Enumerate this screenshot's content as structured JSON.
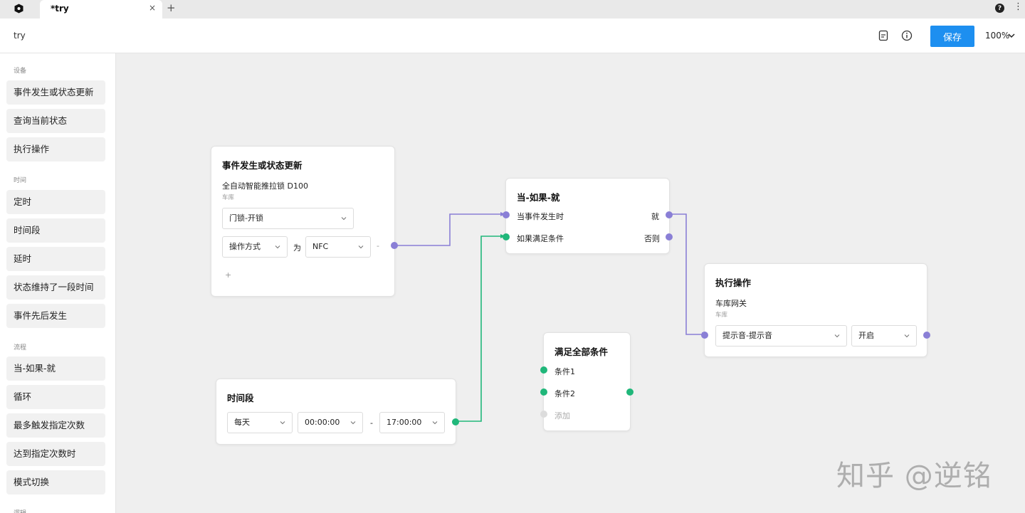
{
  "tabbar": {
    "tab_title": "*try",
    "tab_close": "×",
    "tab_add": "+",
    "help": "?",
    "more": "⋮"
  },
  "header": {
    "doc_name": "try",
    "save_label": "保存",
    "zoom": "100%"
  },
  "sidebar": {
    "sections": [
      {
        "title": "设备",
        "items": [
          "事件发生或状态更新",
          "查询当前状态",
          "执行操作"
        ]
      },
      {
        "title": "时间",
        "items": [
          "定时",
          "时间段",
          "延时",
          "状态维持了一段时间",
          "事件先后发生"
        ]
      },
      {
        "title": "流程",
        "items": [
          "当-如果-就",
          "循环",
          "最多触发指定次数",
          "达到指定次数时",
          "模式切换"
        ]
      },
      {
        "title": "逻辑"
      }
    ]
  },
  "nodes": {
    "event": {
      "title": "事件发生或状态更新",
      "device": "全自动智能推拉锁 D100",
      "room": "车库",
      "trigger": "门锁-开锁",
      "param": "操作方式",
      "op": "为",
      "value": "NFC",
      "sep": "-",
      "add": "+"
    },
    "when_if": {
      "title": "当-如果-就",
      "in_when": "当事件发生时",
      "in_if": "如果满足条件",
      "out_then": "就",
      "out_else": "否则"
    },
    "action": {
      "title": "执行操作",
      "device": "车库网关",
      "room": "车库",
      "action": "提示音-提示音",
      "value": "开启"
    },
    "all_cond": {
      "title": "满足全部条件",
      "cond1": "条件1",
      "cond2": "条件2",
      "add": "添加"
    },
    "time_range": {
      "title": "时间段",
      "repeat": "每天",
      "start": "00:00:00",
      "dash": "-",
      "end": "17:00:00"
    }
  },
  "watermark": "知乎 @逆铭",
  "colors": {
    "accent": "#1d8ff0",
    "wire_purple": "#8a7fd6",
    "wire_green": "#20b77a"
  }
}
